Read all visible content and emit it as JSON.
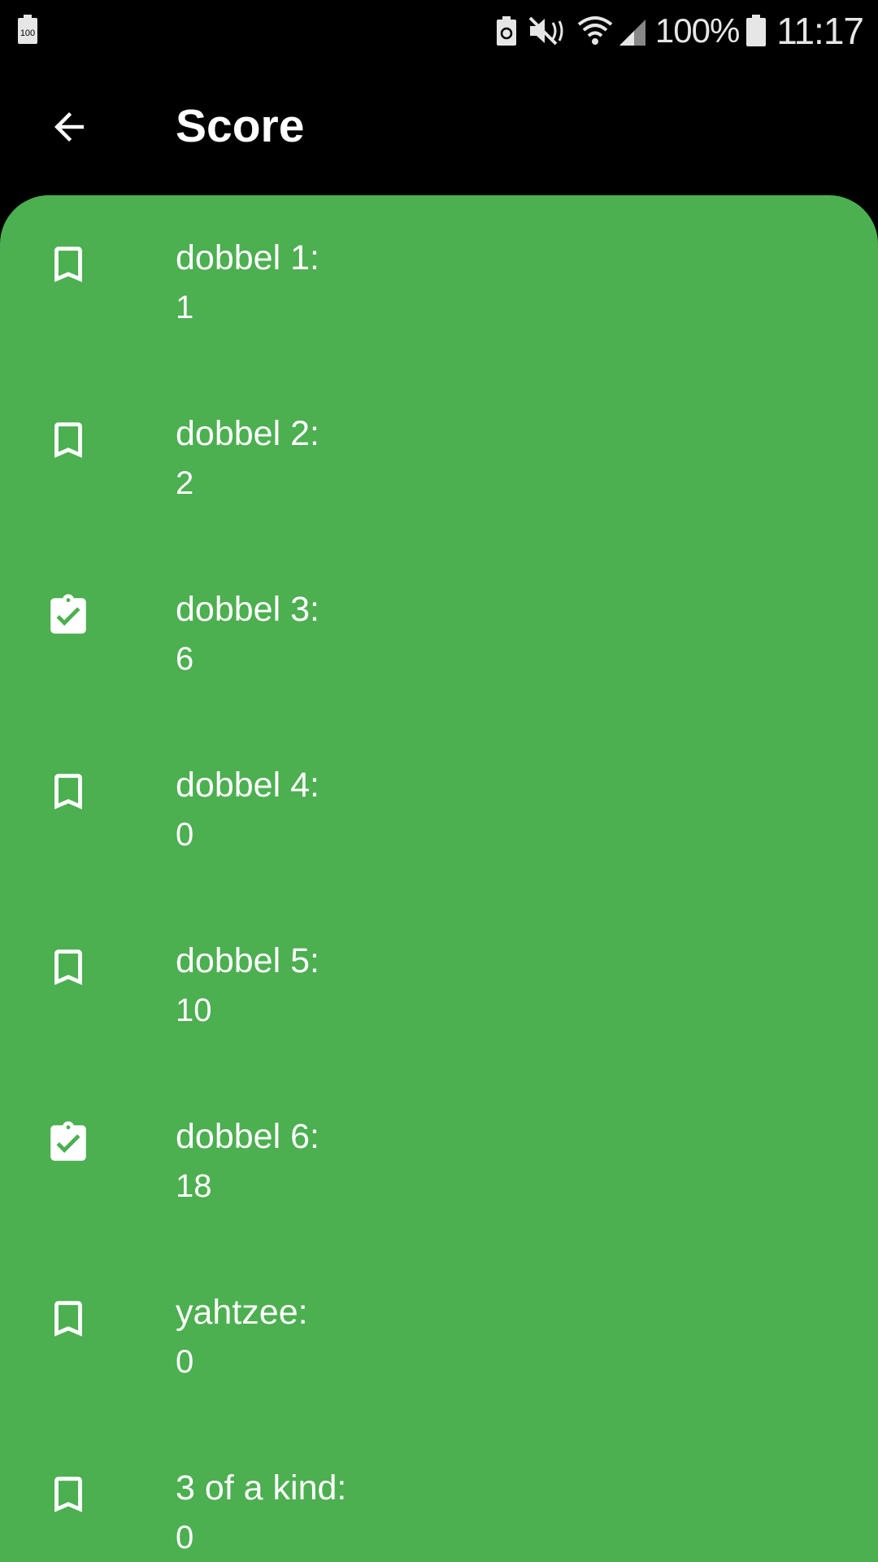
{
  "status_bar": {
    "left_battery_label": "100",
    "battery_percent": "100%",
    "time": "11:17"
  },
  "app_bar": {
    "title": "Score",
    "back_icon": "arrow-back-icon"
  },
  "colors": {
    "sheet_background": "#4caf50",
    "app_bar_background": "#000000",
    "text": "#ffffff"
  },
  "scores": [
    {
      "label": "dobbel 1:",
      "value": "1",
      "icon": "bookmark-icon",
      "locked": false
    },
    {
      "label": "dobbel 2:",
      "value": "2",
      "icon": "bookmark-icon",
      "locked": false
    },
    {
      "label": "dobbel 3:",
      "value": "6",
      "icon": "clipboard-check-icon",
      "locked": true
    },
    {
      "label": "dobbel 4:",
      "value": "0",
      "icon": "bookmark-icon",
      "locked": false
    },
    {
      "label": "dobbel 5:",
      "value": "10",
      "icon": "bookmark-icon",
      "locked": false
    },
    {
      "label": "dobbel 6:",
      "value": "18",
      "icon": "clipboard-check-icon",
      "locked": true
    },
    {
      "label": "yahtzee:",
      "value": "0",
      "icon": "bookmark-icon",
      "locked": false
    },
    {
      "label": "3 of a kind:",
      "value": "0",
      "icon": "bookmark-icon",
      "locked": false
    }
  ]
}
